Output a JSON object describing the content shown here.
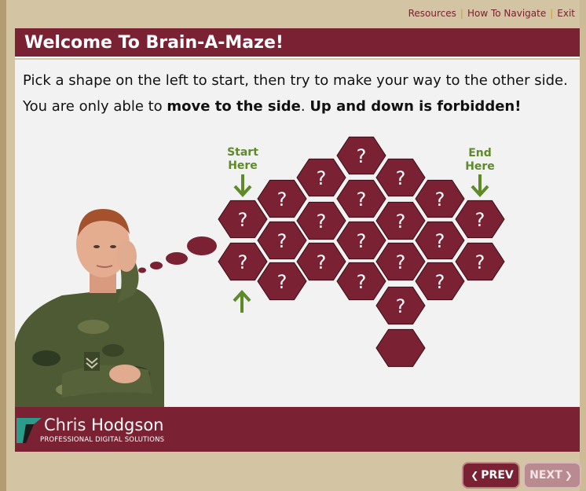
{
  "topnav": {
    "resources": "Resources",
    "how_to_navigate": "How To Navigate",
    "exit": "Exit",
    "separator": "|"
  },
  "title": "Welcome To Brain-A-Maze!",
  "instructions": {
    "part1": "Pick a shape on the left to start, then try to make your way to the other side. You are only able to ",
    "bold1": "move to the side",
    "part2": ". ",
    "bold2": "Up and down is forbidden!"
  },
  "labels": {
    "start": "Start Here",
    "end": "End Here"
  },
  "hex_symbol": "?",
  "hex_color": "#7a2233",
  "arrow_color": "#5e8a2a",
  "footer": {
    "name_light": "Chris",
    "name_bold": "Hodgson",
    "tagline": "PROFESSIONAL DIGITAL SOLUTIONS"
  },
  "buttons": {
    "prev": "PREV",
    "next": "NEXT"
  }
}
